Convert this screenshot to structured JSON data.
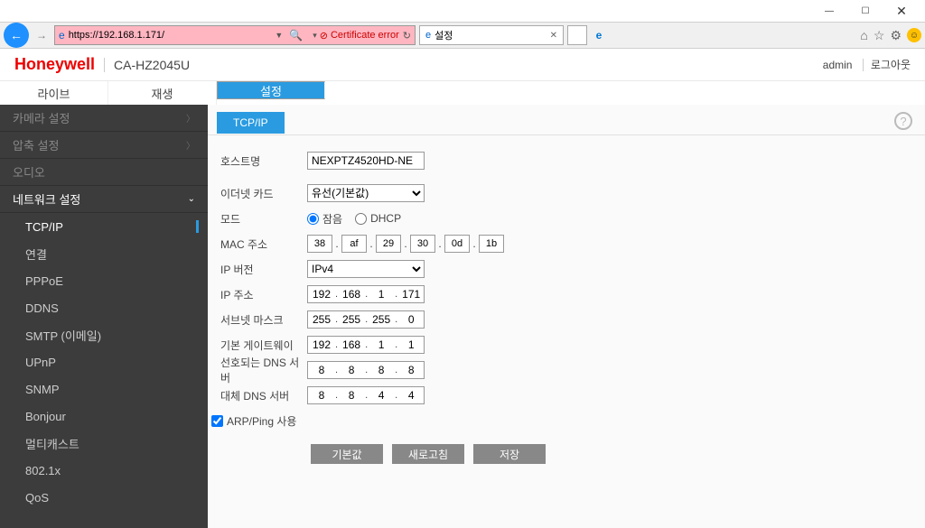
{
  "window": {
    "minimize": "—",
    "maximize": "☐",
    "close": "✕"
  },
  "browser": {
    "url": "https://192.168.1.171/",
    "cert_error": "Certificate error",
    "tab_title": "설정",
    "titlebar_icons": {
      "home": "⌂",
      "star": "☆",
      "gear": "⚙"
    }
  },
  "brand": {
    "name": "Honeywell",
    "model": "CA-HZ2045U",
    "user": "admin",
    "logout": "로그아웃"
  },
  "toptabs": {
    "live": "라이브",
    "playback": "재생",
    "settings": "설정"
  },
  "sidebar": {
    "cat_camera": "카메라 설정",
    "cat_compress": "압축 설정",
    "cat_audio": "오디오",
    "cat_network": "네트워크 설정",
    "subs": {
      "tcpip": "TCP/IP",
      "conn": "연결",
      "pppoe": "PPPoE",
      "ddns": "DDNS",
      "smtp": "SMTP (이메일)",
      "upnp": "UPnP",
      "snmp": "SNMP",
      "bonjour": "Bonjour",
      "multicast": "멀티캐스트",
      "dot1x": "802.1x",
      "qos": "QoS"
    }
  },
  "subtab": {
    "tcpip": "TCP/IP"
  },
  "form": {
    "hostname_lbl": "호스트명",
    "hostname": "NEXPTZ4520HD-NE",
    "eth_lbl": "이더넷 카드",
    "eth": "유선(기본값)",
    "mode_lbl": "모드",
    "mode_static": "잠음",
    "mode_dhcp": "DHCP",
    "mac_lbl": "MAC 주소",
    "mac": [
      "38",
      "af",
      "29",
      "30",
      "0d",
      "1b"
    ],
    "ipver_lbl": "IP 버전",
    "ipver": "IPv4",
    "ipaddr_lbl": "IP 주소",
    "ipaddr": [
      "192",
      "168",
      "1",
      "171"
    ],
    "subnet_lbl": "서브넷 마스크",
    "subnet": [
      "255",
      "255",
      "255",
      "0"
    ],
    "gw_lbl": "기본 게이트웨이",
    "gw": [
      "192",
      "168",
      "1",
      "1"
    ],
    "dns1_lbl": "선호되는 DNS 서버",
    "dns1": [
      "8",
      "8",
      "8",
      "8"
    ],
    "dns2_lbl": "대체 DNS 서버",
    "dns2": [
      "8",
      "8",
      "4",
      "4"
    ],
    "arp_lbl": "ARP/Ping 사용"
  },
  "buttons": {
    "default": "기본값",
    "refresh": "새로고침",
    "save": "저장"
  }
}
